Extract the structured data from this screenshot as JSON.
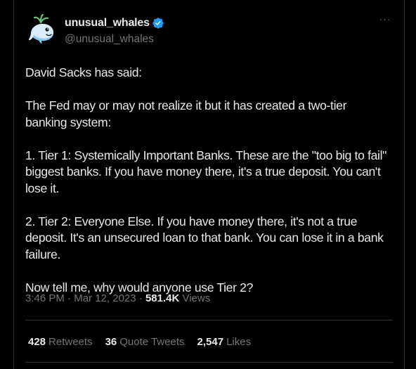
{
  "author": {
    "display_name": "unusual_whales",
    "handle": "@unusual_whales",
    "avatar_icon": "whale-avatar-icon",
    "verified_icon": "verified-badge-icon",
    "verified_color": "#1d9bf0"
  },
  "more_label": "···",
  "tweet": {
    "text": "David Sacks has said:\n\nThe Fed may or may not realize it but it has created a two-tier banking system:\n\n1. Tier 1: Systemically Important Banks. These are the \"too big to fail\" biggest banks. If you have money there, it's a true deposit. You can't lose it.\n\n2. Tier 2: Everyone Else. If you have money there, it's not a true deposit. It's an unsecured loan to that bank. You can lose it in a bank failure.\n\nNow tell me, why would anyone use Tier 2?"
  },
  "meta": {
    "time": "3:46 PM",
    "sep1": " · ",
    "date": "Mar 12, 2023",
    "sep2": " · ",
    "views_count": "581.4K",
    "views_label": " Views"
  },
  "stats": {
    "retweets_count": "428",
    "retweets_label": "Retweets",
    "quotes_count": "36",
    "quotes_label": "Quote Tweets",
    "likes_count": "2,547",
    "likes_label": "Likes"
  },
  "colors": {
    "background": "#000000",
    "text": "#e7e9ea",
    "secondary": "#71767b",
    "border": "#2f3336"
  }
}
